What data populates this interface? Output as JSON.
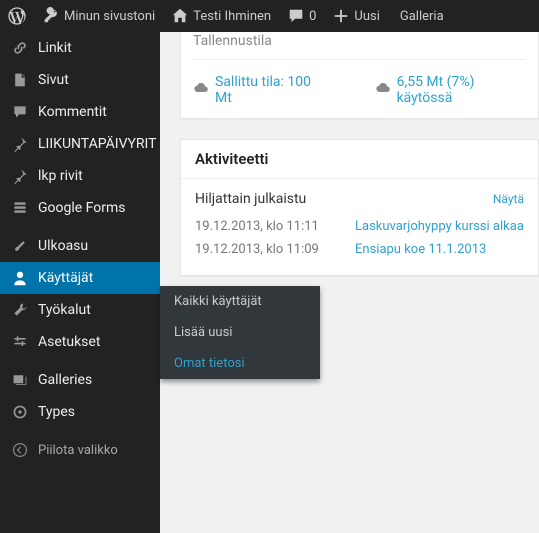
{
  "adminbar": {
    "site_name": "Minun sivustoni",
    "user_name": "Testi Ihminen",
    "comments_count": "0",
    "new_label": "Uusi",
    "gallery_label": "Galleria"
  },
  "sidebar": {
    "items": [
      {
        "label": "Linkit"
      },
      {
        "label": "Sivut"
      },
      {
        "label": "Kommentit"
      },
      {
        "label": "LIIKUNTAPÄIVYRIT"
      },
      {
        "label": "lkp rivit"
      },
      {
        "label": "Google Forms"
      },
      {
        "label": "Ulkoasu"
      },
      {
        "label": "Käyttäjät"
      },
      {
        "label": "Työkalut"
      },
      {
        "label": "Asetukset"
      },
      {
        "label": "Galleries"
      },
      {
        "label": "Types"
      }
    ],
    "collapse_label": "Piilota valikko"
  },
  "submenu": {
    "items": [
      {
        "label": "Kaikki käyttäjät"
      },
      {
        "label": "Lisää uusi"
      },
      {
        "label": "Omat tietosi"
      }
    ]
  },
  "storage": {
    "title": "Tallennustila",
    "allowed": "Sallittu tila: 100 Mt",
    "used": "6,55 Mt (7%) käytössä"
  },
  "activity": {
    "title": "Aktiviteetti",
    "recent_title": "Hiljattain julkaistu",
    "show_label": "Näytä",
    "rows": [
      {
        "date": "19.12.2013, klo 11:11",
        "title": "Laskuvarjohyppy kurssi alkaa"
      },
      {
        "date": "19.12.2013, klo 11:09",
        "title": "Ensiapu koe 11.1.2013"
      }
    ]
  }
}
